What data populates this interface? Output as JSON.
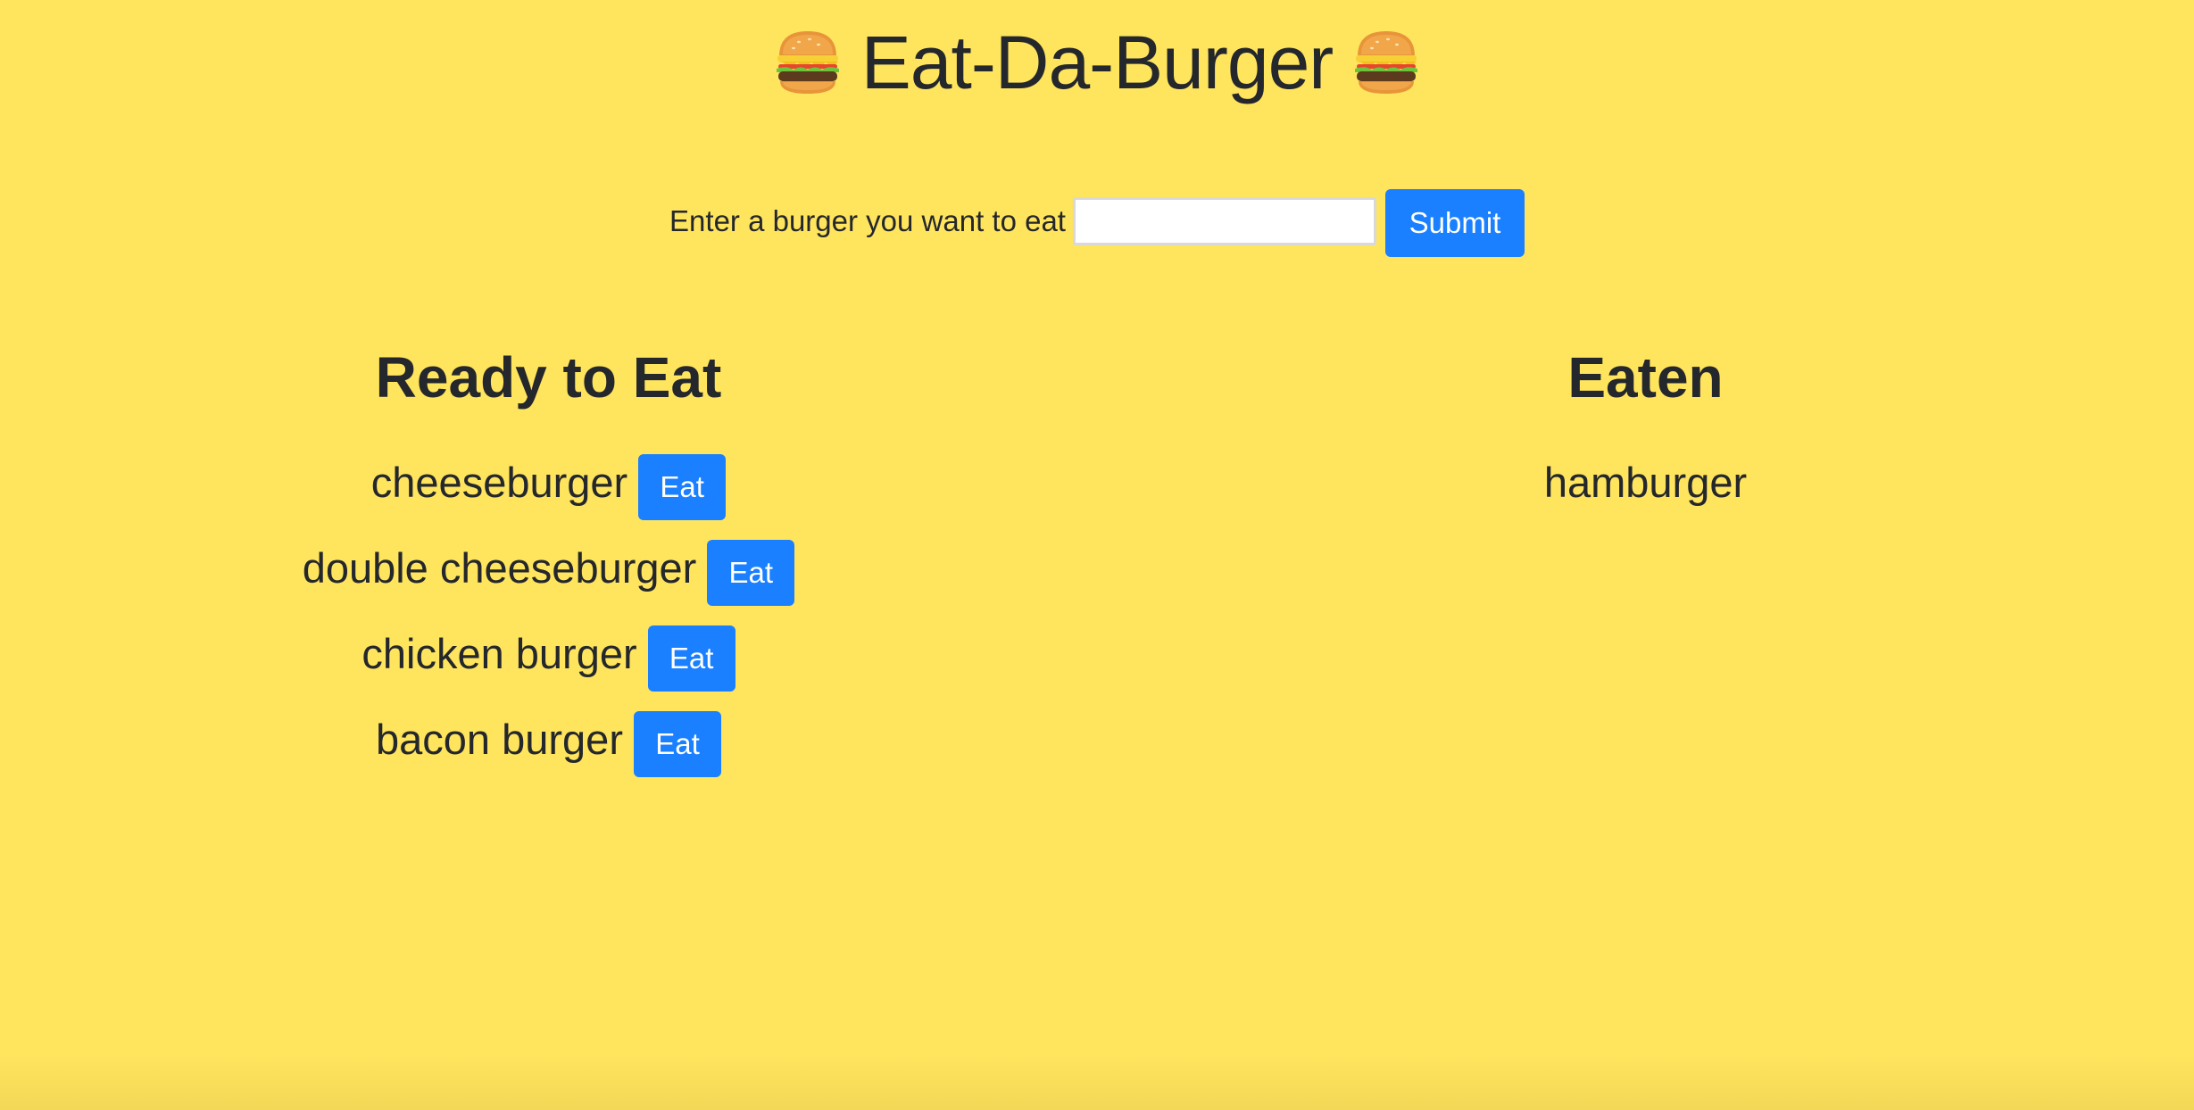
{
  "header": {
    "title": "Eat-Da-Burger",
    "icon": "burger-icon"
  },
  "form": {
    "label": "Enter a burger you want to eat",
    "input_value": "",
    "input_placeholder": "",
    "submit_label": "Submit"
  },
  "ready": {
    "heading": "Ready to Eat",
    "items": [
      {
        "name": "cheeseburger",
        "button": "Eat"
      },
      {
        "name": "double cheeseburger",
        "button": "Eat"
      },
      {
        "name": "chicken burger",
        "button": "Eat"
      },
      {
        "name": "bacon burger",
        "button": "Eat"
      }
    ]
  },
  "eaten": {
    "heading": "Eaten",
    "items": [
      {
        "name": "hamburger"
      }
    ]
  },
  "colors": {
    "background": "#ffe45e",
    "button": "#1a80ff",
    "text": "#24272b"
  }
}
